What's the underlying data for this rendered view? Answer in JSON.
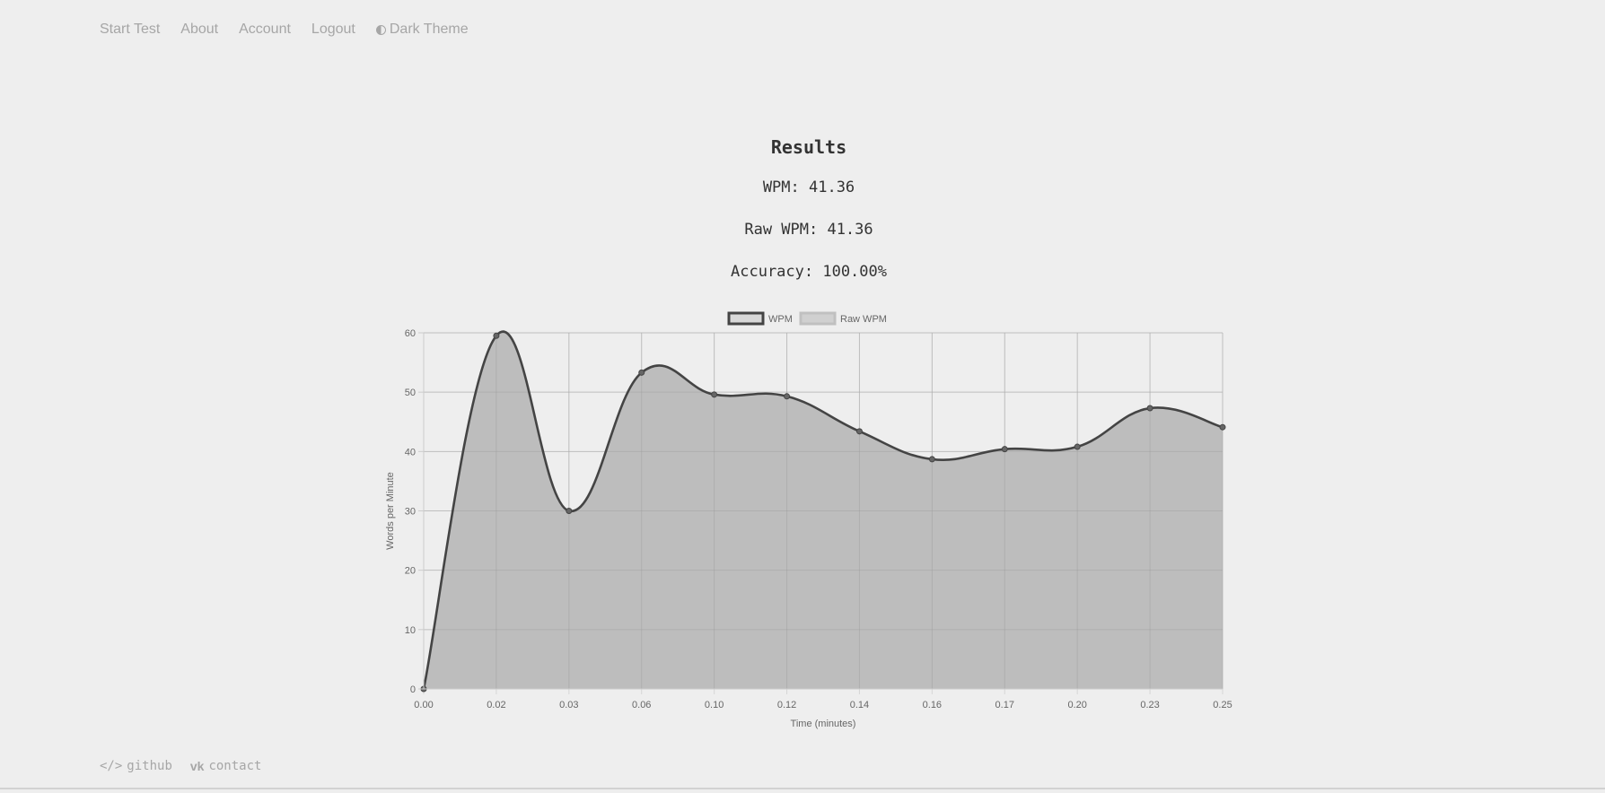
{
  "nav": {
    "items": [
      {
        "label": "Start Test"
      },
      {
        "label": "About"
      },
      {
        "label": "Account"
      },
      {
        "label": "Logout"
      }
    ],
    "theme_label": "Dark Theme",
    "theme_icon": "half-circle-icon"
  },
  "results": {
    "title": "Results",
    "wpm": "WPM: 41.36",
    "raw_wpm": "Raw WPM: 41.36",
    "accuracy": "Accuracy: 100.00%"
  },
  "chart_data": {
    "type": "area",
    "xlabel": "Time (minutes)",
    "ylabel": "Words per Minute",
    "ylim": [
      0,
      60
    ],
    "yticks": [
      0,
      10,
      20,
      30,
      40,
      50,
      60
    ],
    "categories": [
      "0.00",
      "0.02",
      "0.03",
      "0.06",
      "0.10",
      "0.12",
      "0.14",
      "0.16",
      "0.17",
      "0.20",
      "0.23",
      "0.25"
    ],
    "series": [
      {
        "name": "WPM",
        "values": [
          0,
          59.5,
          30,
          53.3,
          49.6,
          49.3,
          43.4,
          38.7,
          40.4,
          40.8,
          47.3,
          44.1
        ],
        "color": "#444444"
      },
      {
        "name": "Raw WPM",
        "values": [
          0,
          59.5,
          30,
          53.3,
          49.6,
          49.3,
          43.4,
          38.7,
          40.4,
          40.8,
          47.3,
          44.1
        ],
        "color": "#c0c0c0"
      }
    ],
    "grid": true,
    "legend": "top-center"
  },
  "footer": {
    "github_label": "github",
    "github_icon": "code-icon",
    "contact_label": "contact",
    "contact_icon": "vk-icon"
  }
}
